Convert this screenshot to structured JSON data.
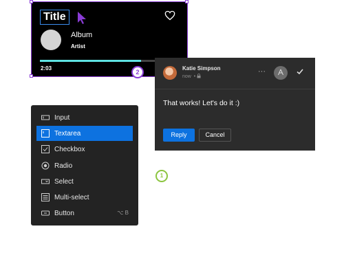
{
  "player": {
    "title": "Title",
    "album": "Album",
    "artist": "Artist",
    "elapsed": "2:03",
    "progress_fraction": 0.73
  },
  "markers": {
    "marker_2": "2",
    "marker_1": "1"
  },
  "comment": {
    "author": "Katie Simpson",
    "time": "now",
    "body": "That works! Let's do it :)",
    "more_label": "···",
    "reply_label": "Reply",
    "cancel_label": "Cancel"
  },
  "menu": {
    "items": [
      {
        "label": "Input",
        "icon": "input-icon",
        "shortcut": ""
      },
      {
        "label": "Textarea",
        "icon": "textarea-icon",
        "shortcut": ""
      },
      {
        "label": "Checkbox",
        "icon": "checkbox-icon",
        "shortcut": ""
      },
      {
        "label": "Radio",
        "icon": "radio-icon",
        "shortcut": ""
      },
      {
        "label": "Select",
        "icon": "select-icon",
        "shortcut": ""
      },
      {
        "label": "Multi-select",
        "icon": "multi-select-icon",
        "shortcut": ""
      },
      {
        "label": "Button",
        "icon": "button-icon",
        "shortcut": "⌥ B"
      }
    ],
    "active_index": 1
  },
  "colors": {
    "accent_blue": "#0d72e0",
    "selection_purple": "#8a3cd6",
    "progress_cyan": "#5fe3e3",
    "marker_green": "#8cc540"
  }
}
